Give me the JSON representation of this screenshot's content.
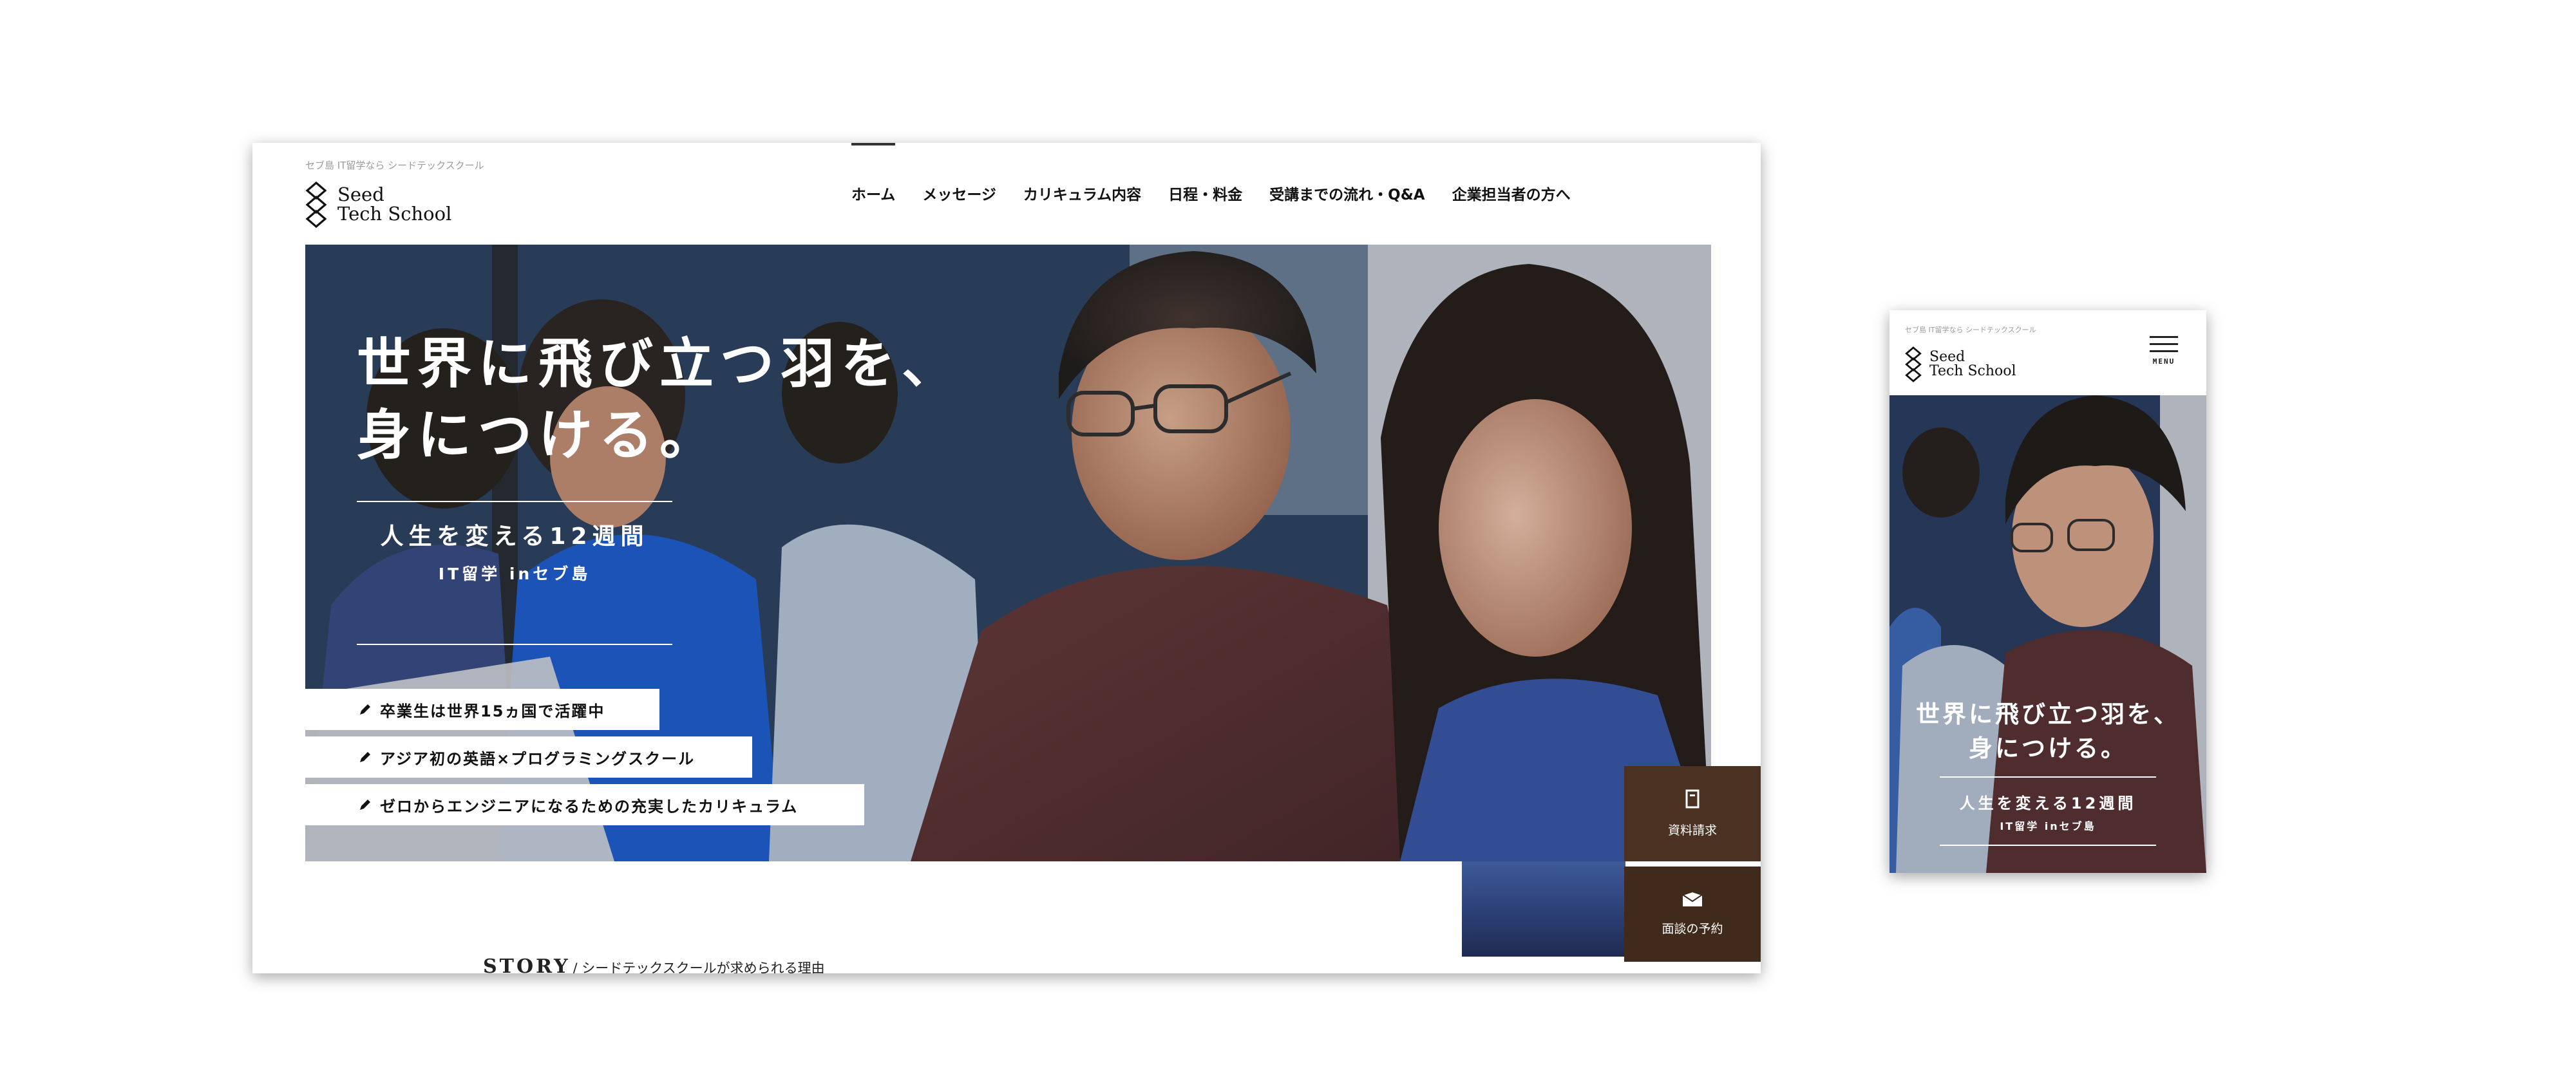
{
  "tagline": "セブ島 IT留学なら シードテックスクール",
  "brand": {
    "line1": "Seed",
    "line2": "Tech School"
  },
  "nav": [
    {
      "label": "ホーム",
      "active": true
    },
    {
      "label": "メッセージ"
    },
    {
      "label": "カリキュラム内容"
    },
    {
      "label": "日程・料金"
    },
    {
      "label": "受講までの流れ・Q&A"
    },
    {
      "label": "企業担当者の方へ"
    }
  ],
  "hero": {
    "title_line1": "世界に飛び立つ羽を、",
    "title_line2": "身につける。",
    "subtitle": "人生を変える12週間",
    "subtitle_small": "IT留学 inセブ島",
    "features": [
      "卒業生は世界15ヵ国で活躍中",
      "アジア初の英語×プログラミングスクール",
      "ゼロからエンジニアになるための充実したカリキュラム"
    ]
  },
  "side_buttons": [
    {
      "label": "資料請求",
      "icon": "document-icon"
    },
    {
      "label": "面談の予約",
      "icon": "envelope-icon"
    }
  ],
  "story": {
    "heading": "STORY",
    "text": "/ シードテックスクールが求められる理由"
  },
  "mobile": {
    "menu_label": "MENU",
    "title_line1": "世界に飛び立つ羽を、",
    "title_line2": "身につける。",
    "subtitle": "人生を変える12週間",
    "subtitle_small": "IT留学 inセブ島"
  },
  "colors": {
    "button_brown": "#4a3121",
    "button_brown_dark": "#3f2a1c",
    "text": "#111111"
  }
}
